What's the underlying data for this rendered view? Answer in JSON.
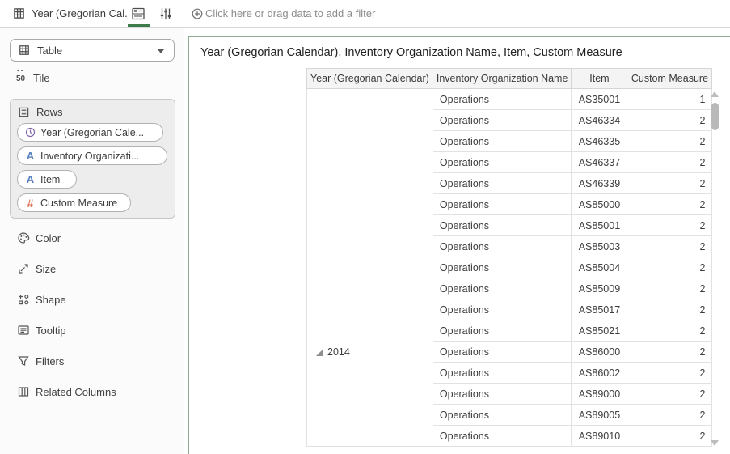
{
  "topbar": {
    "grammar_tab_title": "Year (Gregorian Cal...",
    "filter_placeholder": "Click here or drag data to add a filter"
  },
  "sidebar": {
    "viz_type_selector": {
      "value": "Table"
    },
    "tile": {
      "icon_number": "50",
      "label": "Tile"
    },
    "rows_section": {
      "label": "Rows",
      "pills": [
        {
          "type": "time",
          "label": "Year (Gregorian Cale..."
        },
        {
          "type": "attribute",
          "label": "Inventory Organizati..."
        },
        {
          "type": "attribute",
          "label": "Item"
        },
        {
          "type": "measure",
          "label": "Custom Measure"
        }
      ]
    },
    "items": [
      {
        "label": "Color"
      },
      {
        "label": "Size"
      },
      {
        "label": "Shape"
      },
      {
        "label": "Tooltip"
      },
      {
        "label": "Filters"
      },
      {
        "label": "Related Columns"
      }
    ]
  },
  "main": {
    "title": "Year (Gregorian Calendar), Inventory Organization Name, Item, Custom Measure",
    "table": {
      "columns": [
        "Year (Gregorian Calendar)",
        "Inventory Organization Name",
        "Item",
        "Custom Measure"
      ],
      "year_group": "2014",
      "rows": [
        {
          "org": "Operations",
          "item": "AS35001",
          "measure": "1"
        },
        {
          "org": "Operations",
          "item": "AS46334",
          "measure": "2"
        },
        {
          "org": "Operations",
          "item": "AS46335",
          "measure": "2"
        },
        {
          "org": "Operations",
          "item": "AS46337",
          "measure": "2"
        },
        {
          "org": "Operations",
          "item": "AS46339",
          "measure": "2"
        },
        {
          "org": "Operations",
          "item": "AS85000",
          "measure": "2"
        },
        {
          "org": "Operations",
          "item": "AS85001",
          "measure": "2"
        },
        {
          "org": "Operations",
          "item": "AS85003",
          "measure": "2"
        },
        {
          "org": "Operations",
          "item": "AS85004",
          "measure": "2"
        },
        {
          "org": "Operations",
          "item": "AS85009",
          "measure": "2"
        },
        {
          "org": "Operations",
          "item": "AS85017",
          "measure": "2"
        },
        {
          "org": "Operations",
          "item": "AS85021",
          "measure": "2"
        },
        {
          "org": "Operations",
          "item": "AS86000",
          "measure": "2"
        },
        {
          "org": "Operations",
          "item": "AS86002",
          "measure": "2"
        },
        {
          "org": "Operations",
          "item": "AS89000",
          "measure": "2"
        },
        {
          "org": "Operations",
          "item": "AS89005",
          "measure": "2"
        },
        {
          "org": "Operations",
          "item": "AS89010",
          "measure": "2"
        }
      ]
    }
  },
  "colors": {
    "accent_green": "#3e7d4b",
    "selected_viz_border": "#8fac91",
    "time_icon": "#8568aa",
    "attribute_icon": "#5780be",
    "measure_icon": "#dd6b4d"
  }
}
